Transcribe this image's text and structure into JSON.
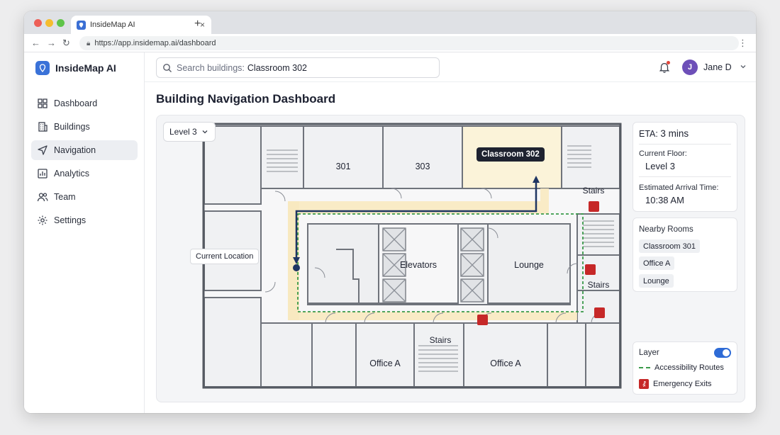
{
  "browser": {
    "tab_title": "InsideMap AI",
    "url": "https://app.insidemap.ai/dashboard"
  },
  "app": {
    "brand": "InsideMap AI",
    "accent": "#3a72d8"
  },
  "sidebar": {
    "items": [
      {
        "label": "Dashboard",
        "icon": "grid-icon",
        "active": false
      },
      {
        "label": "Buildings",
        "icon": "building-icon",
        "active": false
      },
      {
        "label": "Navigation",
        "icon": "navigation-arrow-icon",
        "active": true
      },
      {
        "label": "Analytics",
        "icon": "bar-chart-icon",
        "active": false
      },
      {
        "label": "Team",
        "icon": "users-icon",
        "active": false
      },
      {
        "label": "Settings",
        "icon": "gear-icon",
        "active": false
      }
    ]
  },
  "search": {
    "placeholder": "Search buildings:",
    "value": "Classroom 302"
  },
  "user": {
    "initial": "J",
    "name": "Jane D"
  },
  "page": {
    "title": "Building Navigation Dashboard"
  },
  "map": {
    "level_select": "Level 3",
    "current_location_label": "Current Location",
    "destination_label": "Classroom 302",
    "rooms": {
      "r301": "301",
      "r303": "303",
      "stairs_top": "Stairs",
      "stairs_right": "Stairs",
      "stairs_bottom": "Stairs",
      "elevators": "Elevators",
      "lounge": "Lounge",
      "office_left": "Office A",
      "office_right": "Office A"
    }
  },
  "info": {
    "eta_label": "ETA:",
    "eta_value": "3 mins",
    "floor_label": "Current Floor:",
    "floor_value": "Level 3",
    "arrival_label": "Estimated Arrival Time:",
    "arrival_value": "10:38 AM"
  },
  "nearby": {
    "title": "Nearby Rooms",
    "rooms": [
      "Classroom 301",
      "Office A",
      "Lounge"
    ]
  },
  "layer": {
    "title": "Layer",
    "enabled": true,
    "items": [
      "Accessibility Routes",
      "Emergency Exits"
    ]
  }
}
